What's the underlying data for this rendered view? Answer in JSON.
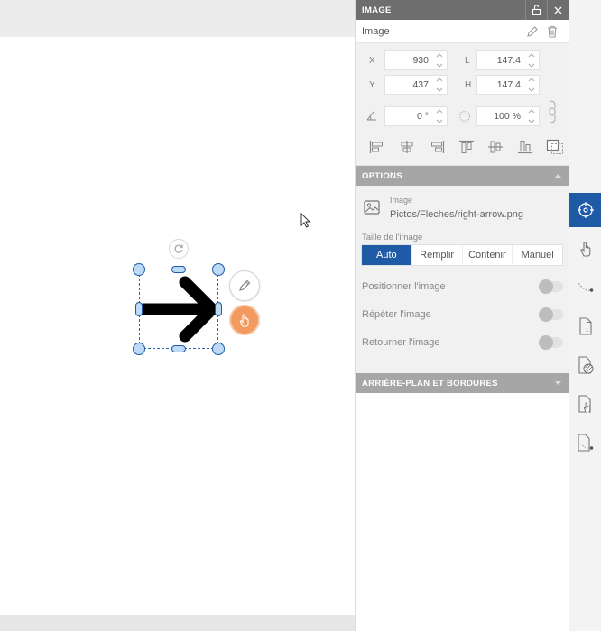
{
  "panel": {
    "title": "IMAGE",
    "element_name": "Image",
    "geometry": {
      "x_label": "X",
      "x_value": "930",
      "y_label": "Y",
      "y_value": "437",
      "w_label": "L",
      "w_value": "147.4",
      "h_label": "H",
      "h_value": "147.4",
      "angle_value": "0 °",
      "opacity_value": "100 %"
    },
    "options": {
      "title": "OPTIONS",
      "image_label": "Image",
      "image_path": "Pictos/Fleches/right-arrow.png",
      "size_label": "Taille de l'image",
      "size_modes": [
        "Auto",
        "Remplir",
        "Contenir",
        "Manuel"
      ],
      "size_selected": "Auto",
      "toggles": [
        {
          "label": "Positionner l'image",
          "on": false
        },
        {
          "label": "Répéter l'image",
          "on": false
        },
        {
          "label": "Retourner l'image",
          "on": false
        }
      ]
    },
    "background_section": {
      "title": "ARRIÈRE-PLAN ET BORDURES"
    }
  },
  "vbar": {
    "icons": [
      "crosshair-icon",
      "touch-icon",
      "path-icon",
      "page-icon",
      "page-fill-icon",
      "page-touch-icon",
      "page-path-icon"
    ],
    "active": "crosshair-icon"
  },
  "colors": {
    "accent": "#1f5aa6",
    "header": "#6e6e6e",
    "section": "#a6a6a6",
    "touch_button": "#f29a5f"
  }
}
